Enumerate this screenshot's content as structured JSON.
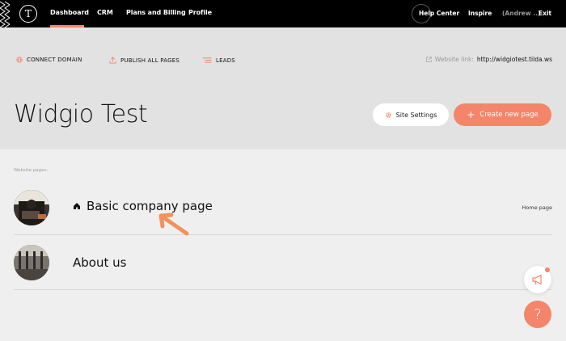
{
  "topbar": {
    "logo_letter": "T",
    "nav": [
      "Dashboard",
      "CRM",
      "Plans and Billing",
      "Profile"
    ],
    "right": {
      "help": "Help Center",
      "inspire": "Inspire",
      "user": "(Andrew ..)",
      "exit": "Exit"
    }
  },
  "header": {
    "actions": {
      "connect_domain": "CONNECT DOMAIN",
      "publish_all": "PUBLISH ALL PAGES",
      "leads": "LEADS"
    },
    "website_link_label": "Website link:",
    "website_link_url": "http://widgiotest.tilda.ws",
    "project_title": "Widgio Test",
    "site_settings": "Site Settings",
    "create_page": "Create new page"
  },
  "pages_section": {
    "label": "Website pages:",
    "pages": [
      {
        "title": "Basic company page",
        "is_home": true,
        "home_tag": "Home page"
      },
      {
        "title": "About us",
        "is_home": false
      }
    ]
  },
  "help_fab": "?",
  "colors": {
    "accent": "#f4846a",
    "topbar": "#000000",
    "header_bg": "#e2e2e2",
    "page_bg": "#efefef"
  },
  "icons": [
    "zigzag-icon",
    "globe-icon",
    "upload-icon",
    "leads-icon",
    "external-link-icon",
    "gear-icon",
    "plus-icon",
    "home-icon",
    "arrow-annotation-icon",
    "megaphone-icon",
    "question-icon"
  ]
}
